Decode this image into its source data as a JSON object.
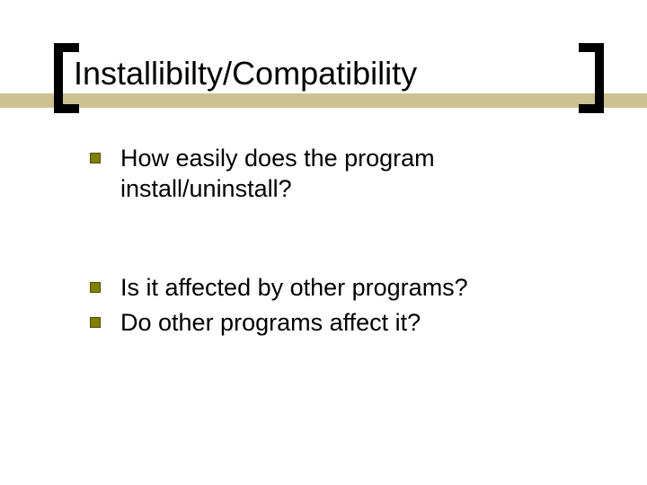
{
  "title": "Installibilty/Compatibility",
  "bullets": {
    "b1": "How easily does the program install/uninstall?",
    "b2": "Is it affected by other programs?",
    "b3": "Do other programs affect it?"
  },
  "colors": {
    "accent_bar": "#cdc190",
    "bullet_fill": "#808000"
  }
}
